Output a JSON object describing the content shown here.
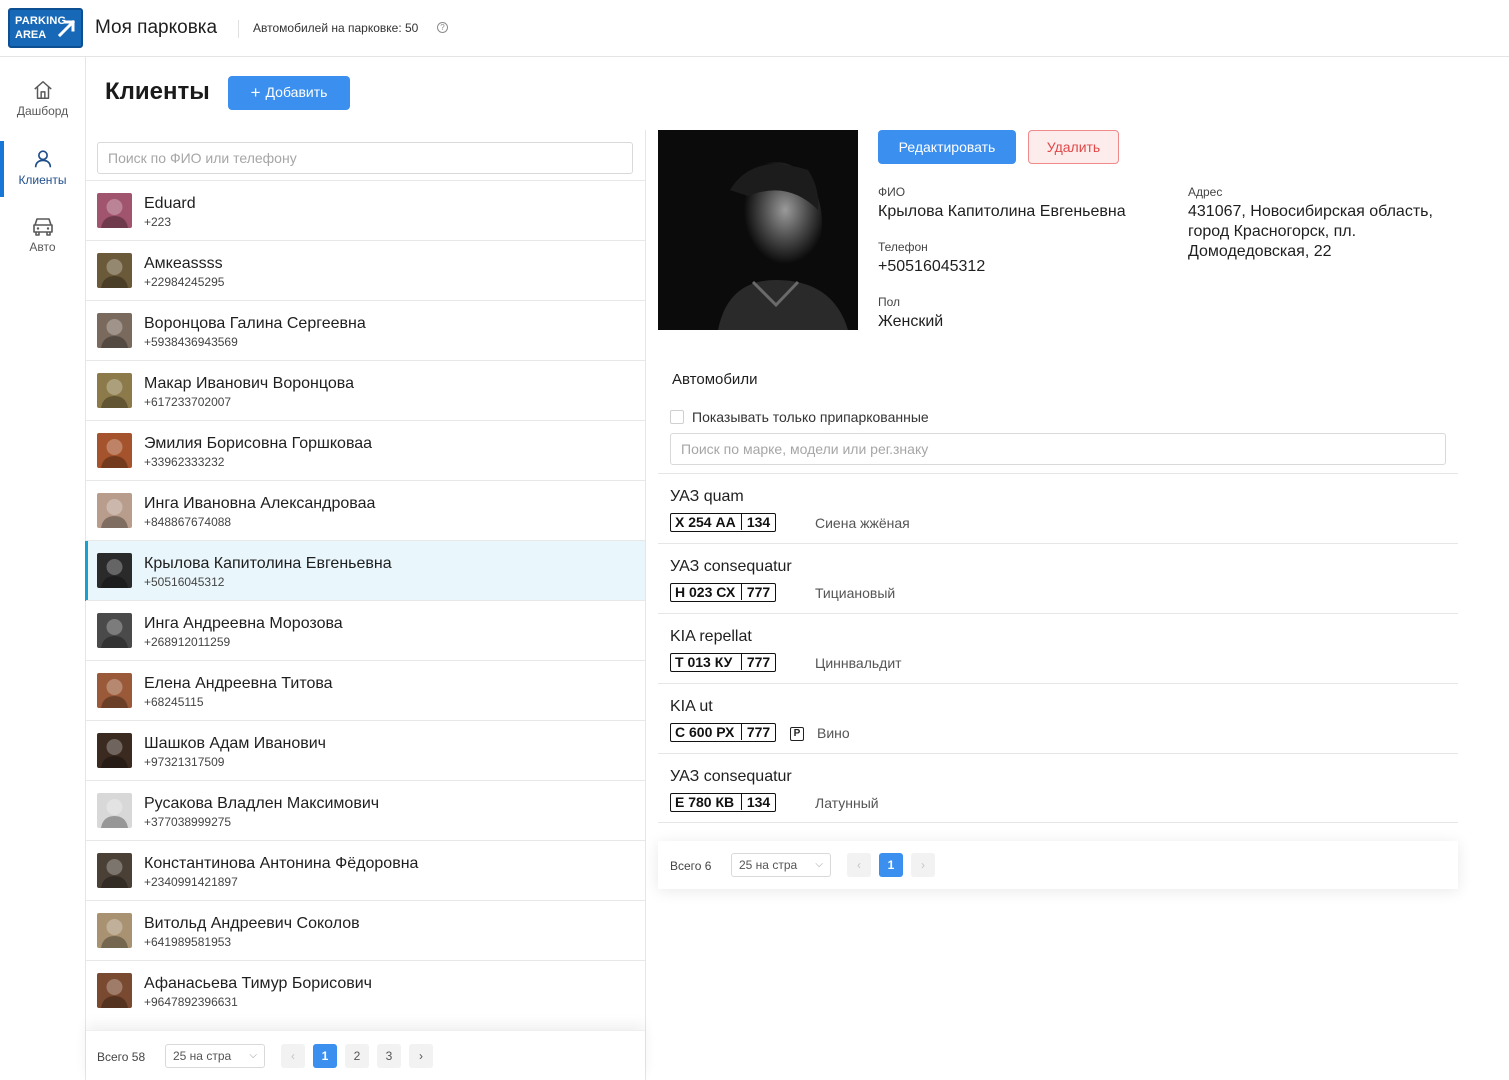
{
  "header": {
    "logo_line1": "PARKING",
    "logo_line2": "AREA",
    "app_title": "Моя парковка",
    "cars_count": "Автомобилей на парковке: 50",
    "help_glyph": "?"
  },
  "sidebar": {
    "items": [
      {
        "label": "Дашборд",
        "icon": "home-icon",
        "active": false
      },
      {
        "label": "Клиенты",
        "icon": "user-icon",
        "active": true
      },
      {
        "label": "Авто",
        "icon": "car-icon",
        "active": false
      }
    ]
  },
  "page": {
    "title": "Клиенты",
    "add_button": "Добавить"
  },
  "clients": {
    "search_placeholder": "Поиск по ФИО или телефону",
    "items": [
      {
        "name": "Eduard",
        "phone": "+223",
        "avatar_color": "#a0546e"
      },
      {
        "name": "Амкеassss",
        "phone": "+22984245295",
        "avatar_color": "#6b5a3a"
      },
      {
        "name": "Воронцова Галина Сергеевна",
        "phone": "+5938436943569",
        "avatar_color": "#7a6a5e"
      },
      {
        "name": "Макар Иванович Воронцова",
        "phone": "+617233702007",
        "avatar_color": "#8c7a4a"
      },
      {
        "name": "Эмилия Борисовна Горшковаа",
        "phone": "+33962333232",
        "avatar_color": "#a5532c"
      },
      {
        "name": "Инга Ивановна Александроваа",
        "phone": "+848867674088",
        "avatar_color": "#b89c8c"
      },
      {
        "name": "Крылова Капитолина Евгеньевна",
        "phone": "+50516045312",
        "avatar_color": "#2a2a2a",
        "active": true
      },
      {
        "name": "Инга Андреевна Морозова",
        "phone": "+268912011259",
        "avatar_color": "#4a4a4a"
      },
      {
        "name": "Елена Андреевна Титова",
        "phone": "+68245115",
        "avatar_color": "#9a5a3a"
      },
      {
        "name": "Шашков Адам Иванович",
        "phone": "+97321317509",
        "avatar_color": "#3a2a20"
      },
      {
        "name": "Русакова Владлен Максимович",
        "phone": "+377038999275",
        "avatar_color": "#d8d8d8"
      },
      {
        "name": "Константинова Антонина Фёдоровна",
        "phone": "+2340991421897",
        "avatar_color": "#4a4036"
      },
      {
        "name": "Витольд Андреевич Соколов",
        "phone": "+641989581953",
        "avatar_color": "#a89272"
      },
      {
        "name": "Афанасьева Тимур Борисович",
        "phone": "+9647892396631",
        "avatar_color": "#7a4a30"
      }
    ],
    "pagination": {
      "total": "Всего 58",
      "page_size": "25 на стра",
      "prev": "‹",
      "next": "›",
      "pages": [
        "1",
        "2",
        "3"
      ],
      "current": "1"
    }
  },
  "detail": {
    "edit_button": "Редактировать",
    "delete_button": "Удалить",
    "fio_label": "ФИО",
    "fio_value": "Крылова Капитолина Евгеньевна",
    "phone_label": "Телефон",
    "phone_value": "+50516045312",
    "gender_label": "Пол",
    "gender_value": "Женский",
    "address_label": "Адрес",
    "address_value": "431067, Новосибирская область, город Красногорск, пл. Домодедовская, 22"
  },
  "cars": {
    "title": "Автомобили",
    "only_parked_label": "Показывать только припаркованные",
    "search_placeholder": "Поиск по марке, модели или рег.знаку",
    "items": [
      {
        "name": "УАЗ quam",
        "plate_number": "Х 254 АА",
        "plate_region": "134",
        "color_name": "Сиена жжёная",
        "parked": false
      },
      {
        "name": "УАЗ consequatur",
        "plate_number": "Н 023 СХ",
        "plate_region": "777",
        "color_name": "Тициановый",
        "parked": false
      },
      {
        "name": "KIA repellat",
        "plate_number": "Т 013 КУ",
        "plate_region": "777",
        "color_name": "Циннвальдит",
        "parked": false
      },
      {
        "name": "KIA ut",
        "plate_number": "С 600 РХ",
        "plate_region": "777",
        "color_name": "Вино",
        "parked": true
      },
      {
        "name": "УАЗ consequatur",
        "plate_number": "Е 780 КВ",
        "plate_region": "134",
        "color_name": "Латунный",
        "parked": false
      }
    ],
    "parked_glyph": "P",
    "pagination": {
      "total": "Всего 6",
      "page_size": "25 на стра",
      "prev": "‹",
      "next": "›",
      "pages": [
        "1"
      ],
      "current": "1"
    }
  },
  "colors": {
    "accent": "#3b8fef",
    "danger": "#e04848",
    "active_row": "#e9f6fb"
  }
}
